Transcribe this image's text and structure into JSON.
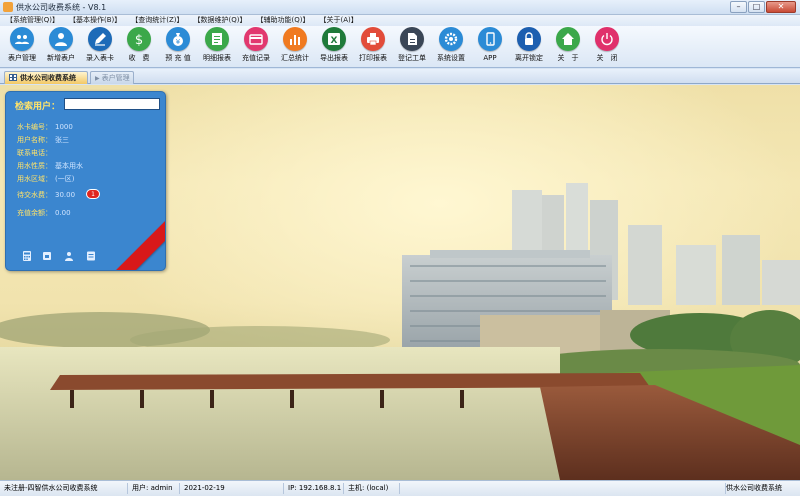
{
  "window": {
    "title": "供水公司收费系统 - V8.1",
    "min": "–",
    "max": "□",
    "close": "✕"
  },
  "menu": [
    "【系统管理(Q)】",
    "【基本操作(B)】",
    "【查询统计(Z)】",
    "【数据维护(Q)】",
    "【辅助功能(Q)】",
    "【关于(A)】"
  ],
  "toolbar": [
    {
      "label": "表户管理",
      "icon": "users-icon",
      "color": "#2b8bd6"
    },
    {
      "label": "新增表户",
      "icon": "user-add-icon",
      "color": "#2b8bd6"
    },
    {
      "label": "录入表卡",
      "icon": "pencil-icon",
      "color": "#1d6bb8"
    },
    {
      "label": "收　费",
      "icon": "dollar-icon",
      "color": "#3ba84a"
    },
    {
      "label": "预 充 值",
      "icon": "moneybag-icon",
      "color": "#2b8bd6"
    },
    {
      "label": "明细报表",
      "icon": "report-icon",
      "color": "#3ba84a"
    },
    {
      "label": "充值记录",
      "icon": "card-icon",
      "color": "#e2386f"
    },
    {
      "label": "汇总统计",
      "icon": "bar-chart-icon",
      "color": "#f07a20"
    },
    {
      "label": "导出报表",
      "icon": "excel-icon",
      "color": "#1f7a3a"
    },
    {
      "label": "打印报表",
      "icon": "printer-icon",
      "color": "#e24c3a"
    },
    {
      "label": "登记工单",
      "icon": "document-icon",
      "color": "#3a4656"
    },
    {
      "label": "系统设置",
      "icon": "gear-icon",
      "color": "#2b8bd6"
    },
    {
      "label": "APP",
      "icon": "phone-icon",
      "color": "#2b8bd6"
    },
    {
      "label": "离开锁定",
      "icon": "lock-icon",
      "color": "#1d5fb0"
    },
    {
      "label": "关　于",
      "icon": "home-icon",
      "color": "#3ba84a"
    },
    {
      "label": "关　闭",
      "icon": "power-icon",
      "color": "#e0306b"
    }
  ],
  "tabs": {
    "active": "供水公司收费系统",
    "inactive": "表户管理"
  },
  "panel": {
    "search_label": "检索用户：",
    "search_value": "",
    "fields": [
      {
        "label": "水卡编号：",
        "value": "1000"
      },
      {
        "label": "用户名称：",
        "value": "张三"
      },
      {
        "label": "联系电话：",
        "value": ""
      },
      {
        "label": "用水性质：",
        "value": "基本用水"
      },
      {
        "label": "用水区域：",
        "value": "(一区)"
      },
      {
        "label": "待交水费：",
        "value": "30.00"
      },
      {
        "label": "充值余额：",
        "value": "0.00"
      }
    ],
    "badge": "1",
    "buttons": [
      "calculator-icon",
      "print-icon",
      "user-icon",
      "list-icon"
    ]
  },
  "status": {
    "registered": "未注册-四智供水公司收费系统",
    "user": "用户: admin",
    "date": "2021-02-19",
    "ip": "IP: 192.168.8.1",
    "host": "主机: (local)",
    "app_name": "供水公司收费系统"
  }
}
